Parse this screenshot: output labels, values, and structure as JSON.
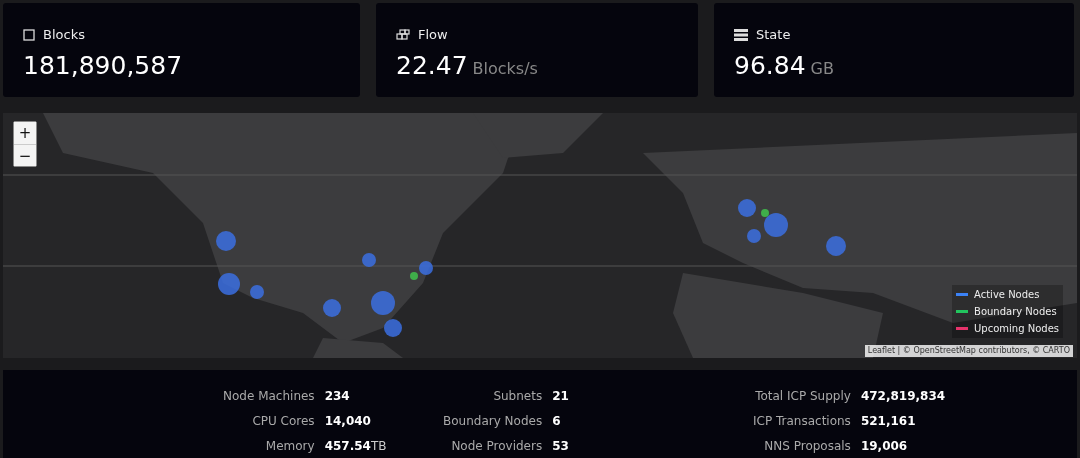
{
  "cards": [
    {
      "kind": "square",
      "label": "Blocks",
      "value": "181,890,587"
    },
    {
      "kind": "flow",
      "label": "Flow",
      "value": "22.47",
      "unit": "Blocks/s"
    },
    {
      "kind": "list",
      "label": "State",
      "value": "96.84",
      "unit": "GB"
    }
  ],
  "map": {
    "zoom_in": "+",
    "zoom_out": "−",
    "legend": [
      {
        "label": "Active Nodes",
        "color": "#3b82f6"
      },
      {
        "label": "Boundary Nodes",
        "color": "#22c55e"
      },
      {
        "label": "Upcoming Nodes",
        "color": "#e6336b"
      }
    ],
    "attribution": {
      "link1": "Leaflet",
      "sep": "| ©",
      "link2": "OpenStreetMap",
      "text": "contributors, ©",
      "link3": "CARTO"
    }
  },
  "stats": [
    [
      {
        "label": "Node Machines",
        "value": "234"
      },
      {
        "label": "CPU Cores",
        "value": "14,040"
      },
      {
        "label": "Memory",
        "value": "457.54",
        "unit": "TB"
      }
    ],
    [
      {
        "label": "Subnets",
        "value": "21"
      },
      {
        "label": "Boundary Nodes",
        "value": "6"
      },
      {
        "label": "Node Providers",
        "value": "53"
      }
    ],
    [
      {
        "label": "Total ICP Supply",
        "value": "472,819,834"
      },
      {
        "label": "ICP Transactions",
        "value": "521,161"
      },
      {
        "label": "NNS Proposals",
        "value": "19,006"
      }
    ]
  ]
}
